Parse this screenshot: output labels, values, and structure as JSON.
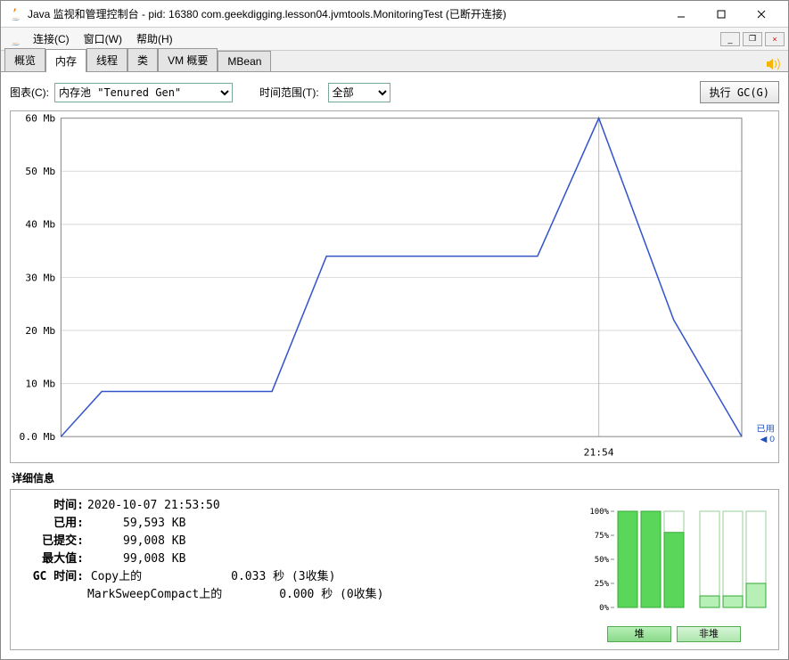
{
  "window": {
    "title": "Java 监视和管理控制台 - pid: 16380 com.geekdigging.lesson04.jvmtools.MonitoringTest (已断开连接)"
  },
  "menu": {
    "connect": "连接(C)",
    "window": "窗口(W)",
    "help": "帮助(H)"
  },
  "tabs": {
    "overview": "概览",
    "memory": "内存",
    "threads": "线程",
    "classes": "类",
    "vmsummary": "VM 概要",
    "mbean": "MBean"
  },
  "controls": {
    "chart_label": "图表(C):",
    "pool_value": "内存池 \"Tenured Gen\"",
    "range_label": "时间范围(T):",
    "range_value": "全部",
    "gc_button": "执行 GC(G)"
  },
  "chart_data": {
    "type": "line",
    "ylabel_unit": "Mb",
    "ylim": [
      0,
      60
    ],
    "yticks": [
      0.0,
      10,
      20,
      30,
      40,
      50,
      60
    ],
    "ytick_labels": [
      "0.0 Mb",
      "10 Mb",
      "20 Mb",
      "30 Mb",
      "40 Mb",
      "50 Mb",
      "60 Mb"
    ],
    "x_tick_label": "21:54",
    "series": [
      {
        "name": "已用",
        "values": [
          0,
          8.5,
          8.5,
          8.5,
          34,
          34,
          34,
          34,
          60,
          22,
          0
        ],
        "x_frac": [
          0.0,
          0.06,
          0.23,
          0.31,
          0.39,
          0.55,
          0.62,
          0.7,
          0.79,
          0.9,
          1.0
        ]
      }
    ],
    "annotation": {
      "text": "已用",
      "value": 0,
      "color": "#2050c0"
    }
  },
  "details": {
    "section_title": "详细信息",
    "time_label": "时间:",
    "time_value": "2020-10-07 21:53:50",
    "used_label": "已用:",
    "used_value": "59,593 KB",
    "committed_label": "已提交:",
    "committed_value": "99,008 KB",
    "max_label": "最大值:",
    "max_value": "99,008 KB",
    "gc_label": "GC 时间:",
    "gc_copy": "Copy上的",
    "gc_copy_time": "0.033 秒 (3收集)",
    "gc_msc": "MarkSweepCompact上的",
    "gc_msc_time": "0.000 秒 (0收集)"
  },
  "mini": {
    "yticks": [
      "0%",
      "25%",
      "50%",
      "75%",
      "100%"
    ],
    "heap_bars": [
      100,
      100,
      78
    ],
    "nonheap_bars": [
      12,
      12,
      25
    ],
    "heap_btn": "堆",
    "nonheap_btn": "非堆"
  }
}
